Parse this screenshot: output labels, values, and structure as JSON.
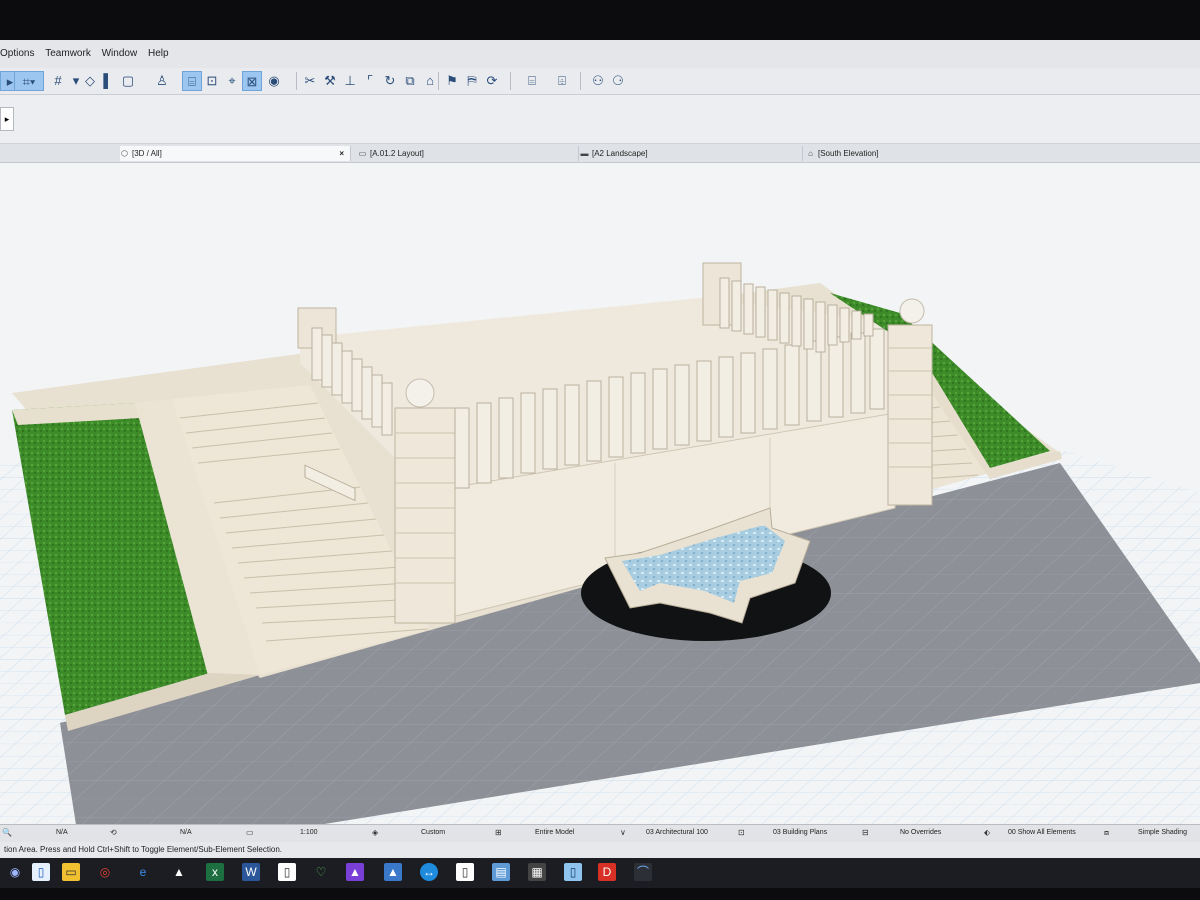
{
  "menu": [
    "Options",
    "Teamwork",
    "Window",
    "Help"
  ],
  "tabs": [
    {
      "label": "[3D / All]",
      "close": "×"
    },
    {
      "label": "[A.01.2 Layout]"
    },
    {
      "label": "[A2 Landscape]"
    },
    {
      "label": "[South Elevation]"
    }
  ],
  "status": {
    "field1": "N/A",
    "field2": "N/A",
    "scale": "1:100",
    "dimension": "Custom",
    "layer_combo": "Entire Model",
    "pen_set": "03 Architectural 100",
    "mvo": "03 Building Plans",
    "overrides": "No Overrides",
    "renovation": "00 Show All Elements",
    "shading": "Simple Shading"
  },
  "hint": "tion Area. Press and Hold Ctrl+Shift to Toggle Element/Sub-Element Selection.",
  "icons": {
    "toolbar": [
      "arrow-tool-icon",
      "select-tool-icon",
      "grid-icon",
      "wall-icon",
      "column-icon",
      "slab-icon",
      "object-icon",
      "stair-icon",
      "dimension-icon",
      "snap-icon",
      "magic-wand-icon",
      "scissors-icon",
      "measure-icon",
      "offset-icon",
      "fillet-icon",
      "rotate-icon",
      "mirror-icon",
      "elevate-icon",
      "flag-icon",
      "layer-icon",
      "renovation-icon",
      "section-icon",
      "detail-icon",
      "teamwork-icon",
      "send-receive-icon"
    ],
    "taskbar": [
      "start-icon",
      "explorer-icon",
      "chrome-icon",
      "edge-icon",
      "archicad-icon",
      "excel-icon",
      "word-icon",
      "file-icon",
      "app-icon",
      "affinity-icon",
      "archicad-2-icon",
      "teamviewer-icon",
      "grapher-icon",
      "calculator-icon",
      "bimx-icon",
      "adobe-icon",
      "archicad-3-icon"
    ]
  },
  "colors": {
    "grass": "#3f8e2a",
    "paving": "#8b8e95",
    "stone": "#ece4d4",
    "water": "#9ec6dc",
    "selected_tool": "#9cc6ef"
  }
}
